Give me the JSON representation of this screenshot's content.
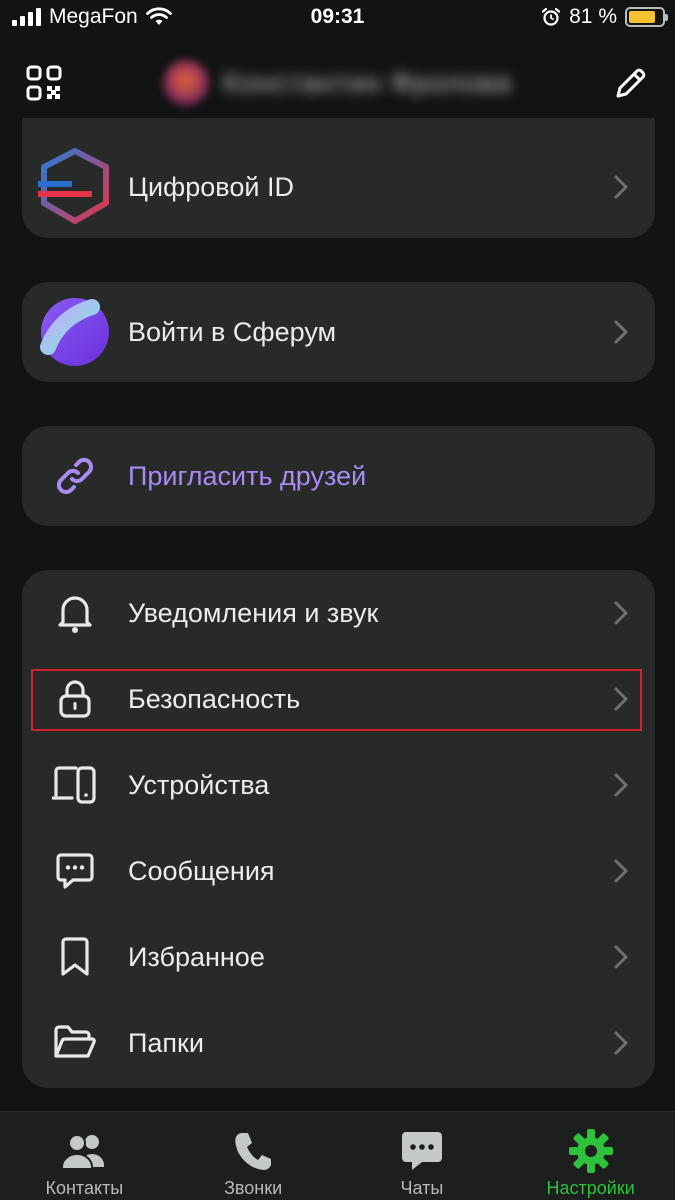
{
  "status_bar": {
    "carrier": "MegaFon",
    "time": "09:31",
    "battery_percent": "81 %",
    "battery_level": 0.81,
    "icons": [
      "signal-icon",
      "wifi-icon",
      "alarm-icon",
      "battery-icon"
    ]
  },
  "header": {
    "icons": [
      "qr-code-icon",
      "edit-pencil-icon"
    ],
    "profile_name": "Константин Фролова",
    "profile_name_blurred": true
  },
  "cards": {
    "digital_id": {
      "label": "Цифровой ID",
      "icon": "digital-id-icon"
    },
    "sferum": {
      "label": "Войти в Сферум",
      "icon": "sferum-icon"
    },
    "invite": {
      "label": "Пригласить друзей",
      "icon": "link-icon"
    }
  },
  "settings_list": [
    {
      "label": "Уведомления и звук",
      "icon": "bell-icon"
    },
    {
      "label": "Безопасность",
      "icon": "lock-icon",
      "highlighted": true
    },
    {
      "label": "Устройства",
      "icon": "devices-icon"
    },
    {
      "label": "Сообщения",
      "icon": "message-icon"
    },
    {
      "label": "Избранное",
      "icon": "bookmark-icon"
    },
    {
      "label": "Папки",
      "icon": "folder-icon"
    }
  ],
  "tab_bar": {
    "tabs": [
      {
        "label": "Контакты",
        "icon": "contacts-icon"
      },
      {
        "label": "Звонки",
        "icon": "phone-icon"
      },
      {
        "label": "Чаты",
        "icon": "chat-icon"
      },
      {
        "label": "Настройки",
        "icon": "gear-icon",
        "active": true
      }
    ]
  },
  "colors": {
    "background": "#121413",
    "card": "#272a29",
    "accent_purple": "#a88cf4",
    "active_green": "#2ec13b",
    "highlight_red": "#d0242a"
  }
}
